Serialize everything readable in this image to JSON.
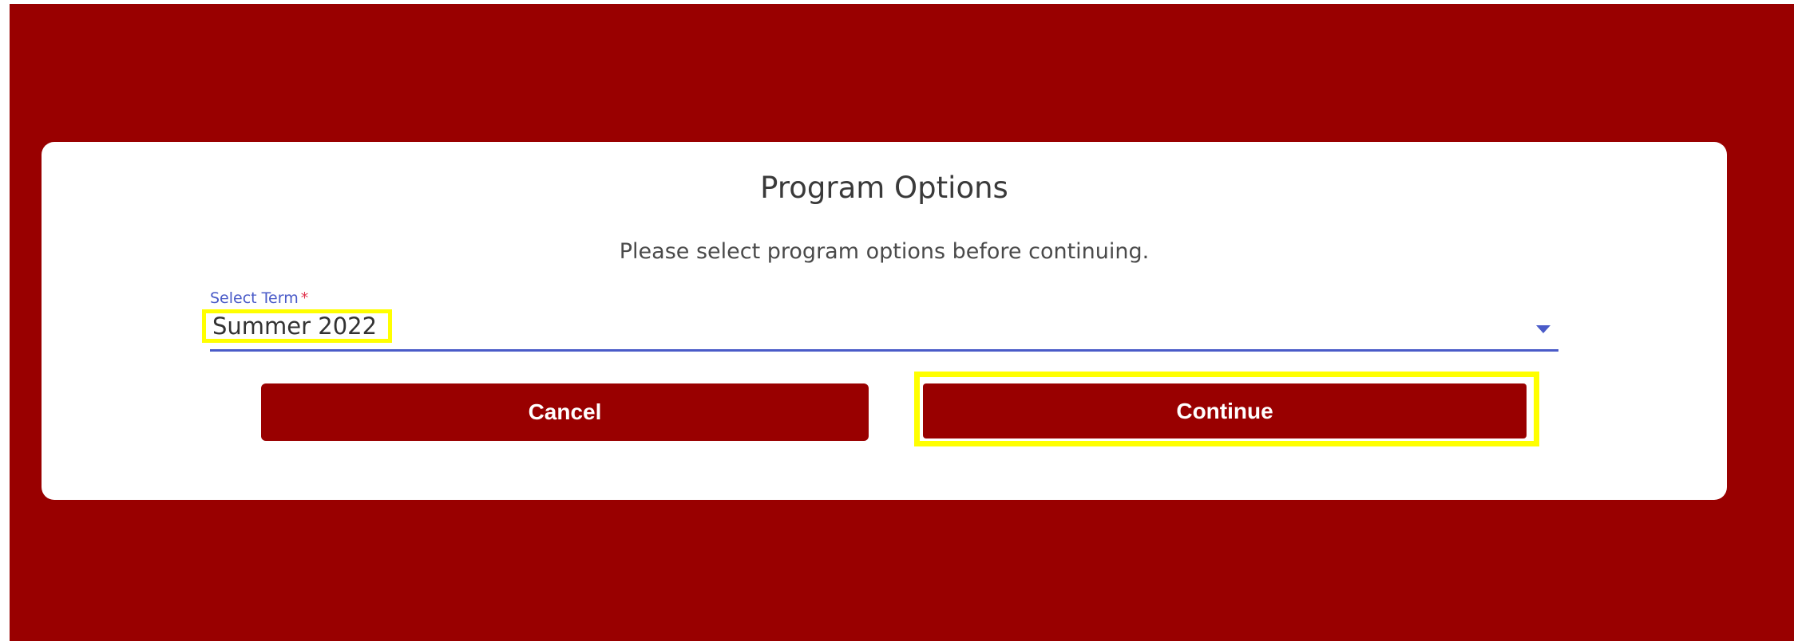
{
  "dialog": {
    "title": "Program Options",
    "subtitle": "Please select program options before continuing."
  },
  "term_select": {
    "label": "Select Term",
    "required_marker": "*",
    "value": "Summer 2022"
  },
  "buttons": {
    "cancel_label": "Cancel",
    "continue_label": "Continue"
  },
  "colors": {
    "background": "#990000",
    "dialog": "#ffffff",
    "accent": "#4a5bc8",
    "highlight": "#ffff00",
    "button": "#990000"
  },
  "icons": {
    "select_arrow": "caret-down-icon"
  }
}
